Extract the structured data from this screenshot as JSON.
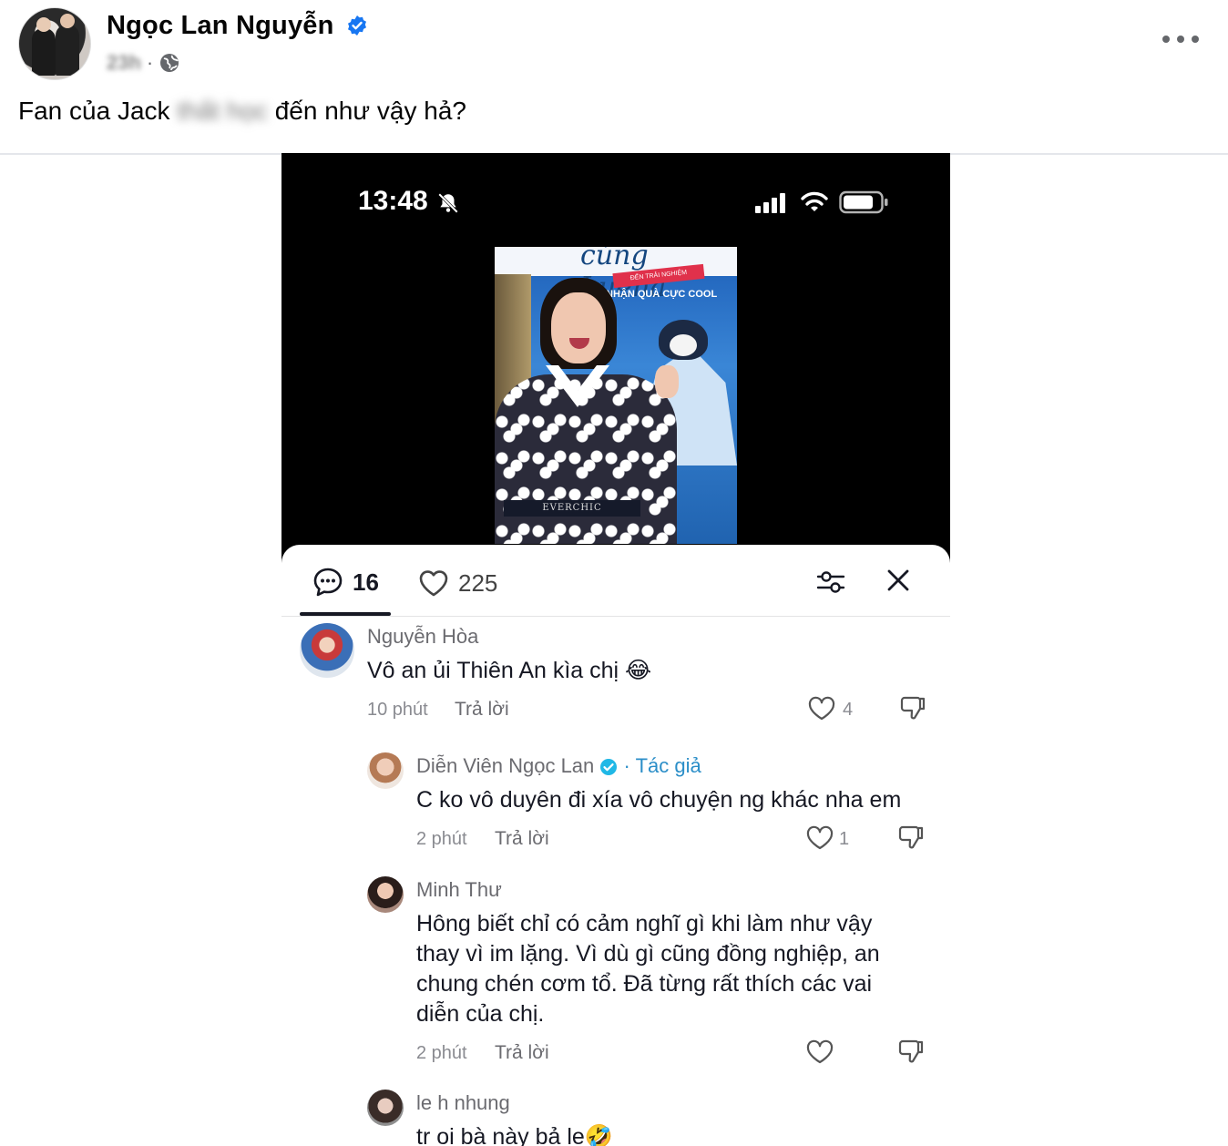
{
  "post": {
    "author": "Ngọc Lan Nguyễn",
    "time": "23h",
    "separator": "·",
    "caption_visible_start": "Fan của Jack ",
    "caption_blurred": "thất học",
    "caption_visible_end": " đến như vậy hả?"
  },
  "phone": {
    "status_time": "13:48",
    "video_banner_text": "cùng Luena",
    "video_ribbon": "ĐẾN TRẢI NGHIỆM",
    "video_promo": "NHẬN QUÀ CỰC COOL",
    "video_belt": "EVERCHIC"
  },
  "sheet": {
    "comments_count": "16",
    "likes_count": "225"
  },
  "comments": [
    {
      "name": "Nguyễn Hòa",
      "text": "Vô an ủi Thiên An kìa chị 😂",
      "time": "10 phút",
      "reply": "Trả lời",
      "likes": "4"
    },
    {
      "name": "Diễn Viên Ngọc Lan",
      "author_tag": "· Tác giả",
      "text": "C ko vô duyên đi xía vô chuyện ng khác nha em",
      "time": "2 phút",
      "reply": "Trả lời",
      "likes": "1"
    },
    {
      "name": "Minh Thư",
      "text_lines": [
        "Hông biết chỉ có cảm nghĩ gì khi làm như vậy",
        "thay vì im lặng. Vì dù gì cũng đồng nghiệp, an",
        "chung chén cơm tổ. Đã từng rất thích các vai",
        "diễn của chị."
      ],
      "time": "2 phút",
      "reply": "Trả lời",
      "likes": ""
    },
    {
      "name": "le h nhung",
      "text": "tr oi bà này bả le🤣"
    }
  ],
  "colors": {
    "verified_blue": "#1877f2",
    "tiktok_author_tag": "#2b8ec8",
    "text_primary": "#050505",
    "text_secondary": "#65676b"
  },
  "icons": [
    "verified-badge-icon",
    "globe-icon",
    "more-options-icon",
    "bell-muted-icon",
    "signal-icon",
    "wifi-icon",
    "battery-icon",
    "comment-icon",
    "heart-icon",
    "filter-icon",
    "close-icon",
    "dislike-icon"
  ]
}
